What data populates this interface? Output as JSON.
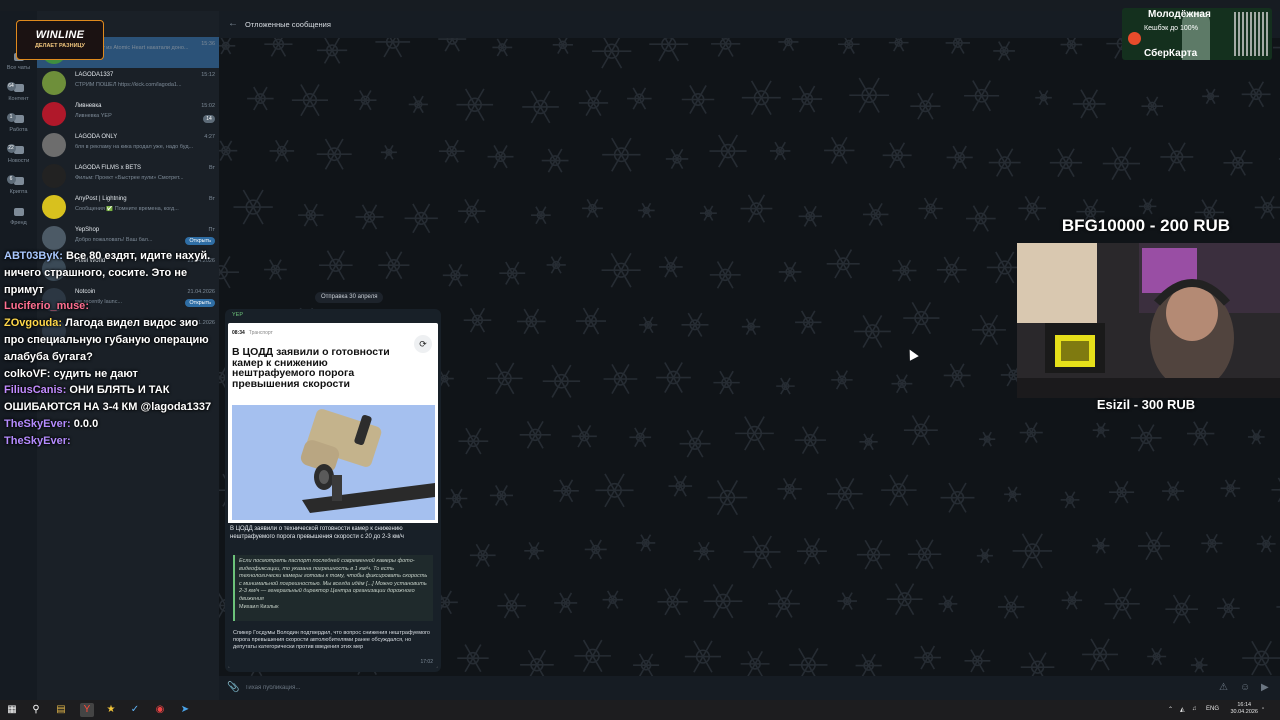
{
  "folders": [
    {
      "label": "Все чаты",
      "badge": "",
      "icon": "chat-bubbles-icon"
    },
    {
      "label": "Контент",
      "badge": "64",
      "icon": "folder-icon"
    },
    {
      "label": "Работа",
      "badge": "1",
      "icon": "folder-icon"
    },
    {
      "label": "Новости",
      "badge": "22",
      "icon": "folder-icon"
    },
    {
      "label": "Крипта",
      "badge": "6",
      "icon": "folder-icon"
    },
    {
      "label": "Френд",
      "badge": "",
      "icon": "folder-icon"
    }
  ],
  "chats": [
    {
      "name": "",
      "time": "15:36",
      "preview": "Вашу винку из Atomic Heart накатали доно...",
      "badge": "",
      "button": "",
      "active": true,
      "avatar_color": "#3f8f3f"
    },
    {
      "name": "LAGODA1337",
      "time": "15:12",
      "preview": "СТРИМ ПОШЕЛ https://kick.com/lagoda1...",
      "badge": "",
      "button": "",
      "active": false,
      "avatar_color": "#6e8f3a"
    },
    {
      "name": "Ливневка",
      "time": "15:02",
      "preview": "Ливневка YEP",
      "badge": "14",
      "button": "",
      "active": false,
      "avatar_color": "#b0182a"
    },
    {
      "name": "LAGODA ONLY",
      "time": "4:27",
      "preview": "бля в рекламу на кика продал уже, надо буд...",
      "badge": "",
      "button": "",
      "active": false,
      "avatar_color": "#6d6d6d"
    },
    {
      "name": "LAGODA FILMS x BETS",
      "time": "Вт",
      "preview": "Фильм: Проект «Быстрее пули» Смотрет...",
      "badge": "",
      "button": "",
      "active": false,
      "avatar_color": "#222222"
    },
    {
      "name": "AnyPost | Lightning",
      "time": "Вт",
      "preview": "Сообщения ✅ Помните времена, когд...",
      "badge": "",
      "button": "",
      "active": false,
      "avatar_color": "#d8c11e"
    },
    {
      "name": "YepShop",
      "time": "Пт",
      "preview": "Добро пожаловать! Ваш бал...",
      "badge": "",
      "button": "Открыть",
      "active": false,
      "avatar_color": "#4c5a66"
    },
    {
      "name": "Pixel World",
      "time": "21.04.2026",
      "preview": "",
      "badge": "",
      "button": "",
      "active": false,
      "avatar_color": "#3b4a57"
    },
    {
      "name": "Notcoin",
      "time": "21.04.2026",
      "preview": "we recently launc...",
      "badge": "",
      "button": "Открыть",
      "active": false,
      "avatar_color": "#2c3743"
    },
    {
      "name": "",
      "time": "01.01.2026",
      "preview": "",
      "badge": "",
      "button": "",
      "active": false,
      "avatar_color": "#2c3743"
    }
  ],
  "stream_chat": [
    {
      "nick": "АВТ03ВуК",
      "nick_color": "#a9c8ff",
      "text": "Все 80 ездят, идите нахуй. ничего страшного, сосите. Это не примут"
    },
    {
      "nick": "Luciferio_muse",
      "nick_color": "#ff6f91",
      "text": ""
    },
    {
      "nick": "ZOvgouda",
      "nick_color": "#ffd84a",
      "text": "Лагода видел видос зио про специальную губаную операцию алабуба бугага?"
    },
    {
      "nick": "colkoVF",
      "nick_color": "#ffffff",
      "text": "судить не дают"
    },
    {
      "nick": "FiliusCanis",
      "nick_color": "#c28cff",
      "text": "ОНИ БЛЯТЬ И ТАК ОШИБАЮТСЯ НА 3-4 КМ @lagoda1337"
    },
    {
      "nick": "TheSkyEver",
      "nick_color": "#b58cff",
      "text": "0.0.0"
    },
    {
      "nick": "TheSkyEver",
      "nick_color": "#b58cff",
      "text": ""
    }
  ],
  "header": {
    "back_icon": "arrow-left-icon",
    "title": "Отложенные сообщения"
  },
  "date_badge": "Отправка 30 апреля",
  "message": {
    "sender": "YEP",
    "card_time": "08:34",
    "card_source": "Транспорт",
    "headline": "В ЦОДД заявили о готовности камер к снижению нештрафуемого порога превышения скорости",
    "caption": "В ЦОДД заявили о технической готовности камер к снижению нештрафуемого порога превышения скорости с 20 до 2-3 км/ч",
    "quote": "Если посмотреть паспорт последней современной камеры фото-видеофиксации, то указана погрешность в 1 км/ч. То есть технологически камеры готовы к тому, чтобы фиксировать скорость с минимальной погрешностью. Мы всегда идём [...] Можно установить 2-3 км/ч — генеральный директор Центра организации дорожного движения",
    "quote_author": "Михаил Кизлык",
    "body": "Спикер Госдумы Володин подтвердил, что вопрос снижения нештрафуемого порога превышения скорости автолюбителями ранее обсуждался, но депутаты категорически против введения этих мер",
    "time": "17:02"
  },
  "composer": {
    "placeholder": "Тихая публикация...",
    "attach_icon": "paperclip-icon"
  },
  "overlays": {
    "winline_title": "WINLINE",
    "winline_sub": "ДЕЛАЕТ РАЗНИЦУ",
    "sber_line1": "Молодёжная",
    "sber_line2": "Кешбэк до 100%",
    "sber_line3": "СберКарта",
    "donation_top": "BFG10000 - 200 RUB",
    "donation_bottom": "Esizil - 300 RUB"
  },
  "taskbar": {
    "lang": "ENG",
    "time": "16:14",
    "date": "30.04.2026"
  },
  "colors": {
    "accent": "#2b5278",
    "sender": "#6cc27a",
    "open_button": "#2f6ea5"
  }
}
